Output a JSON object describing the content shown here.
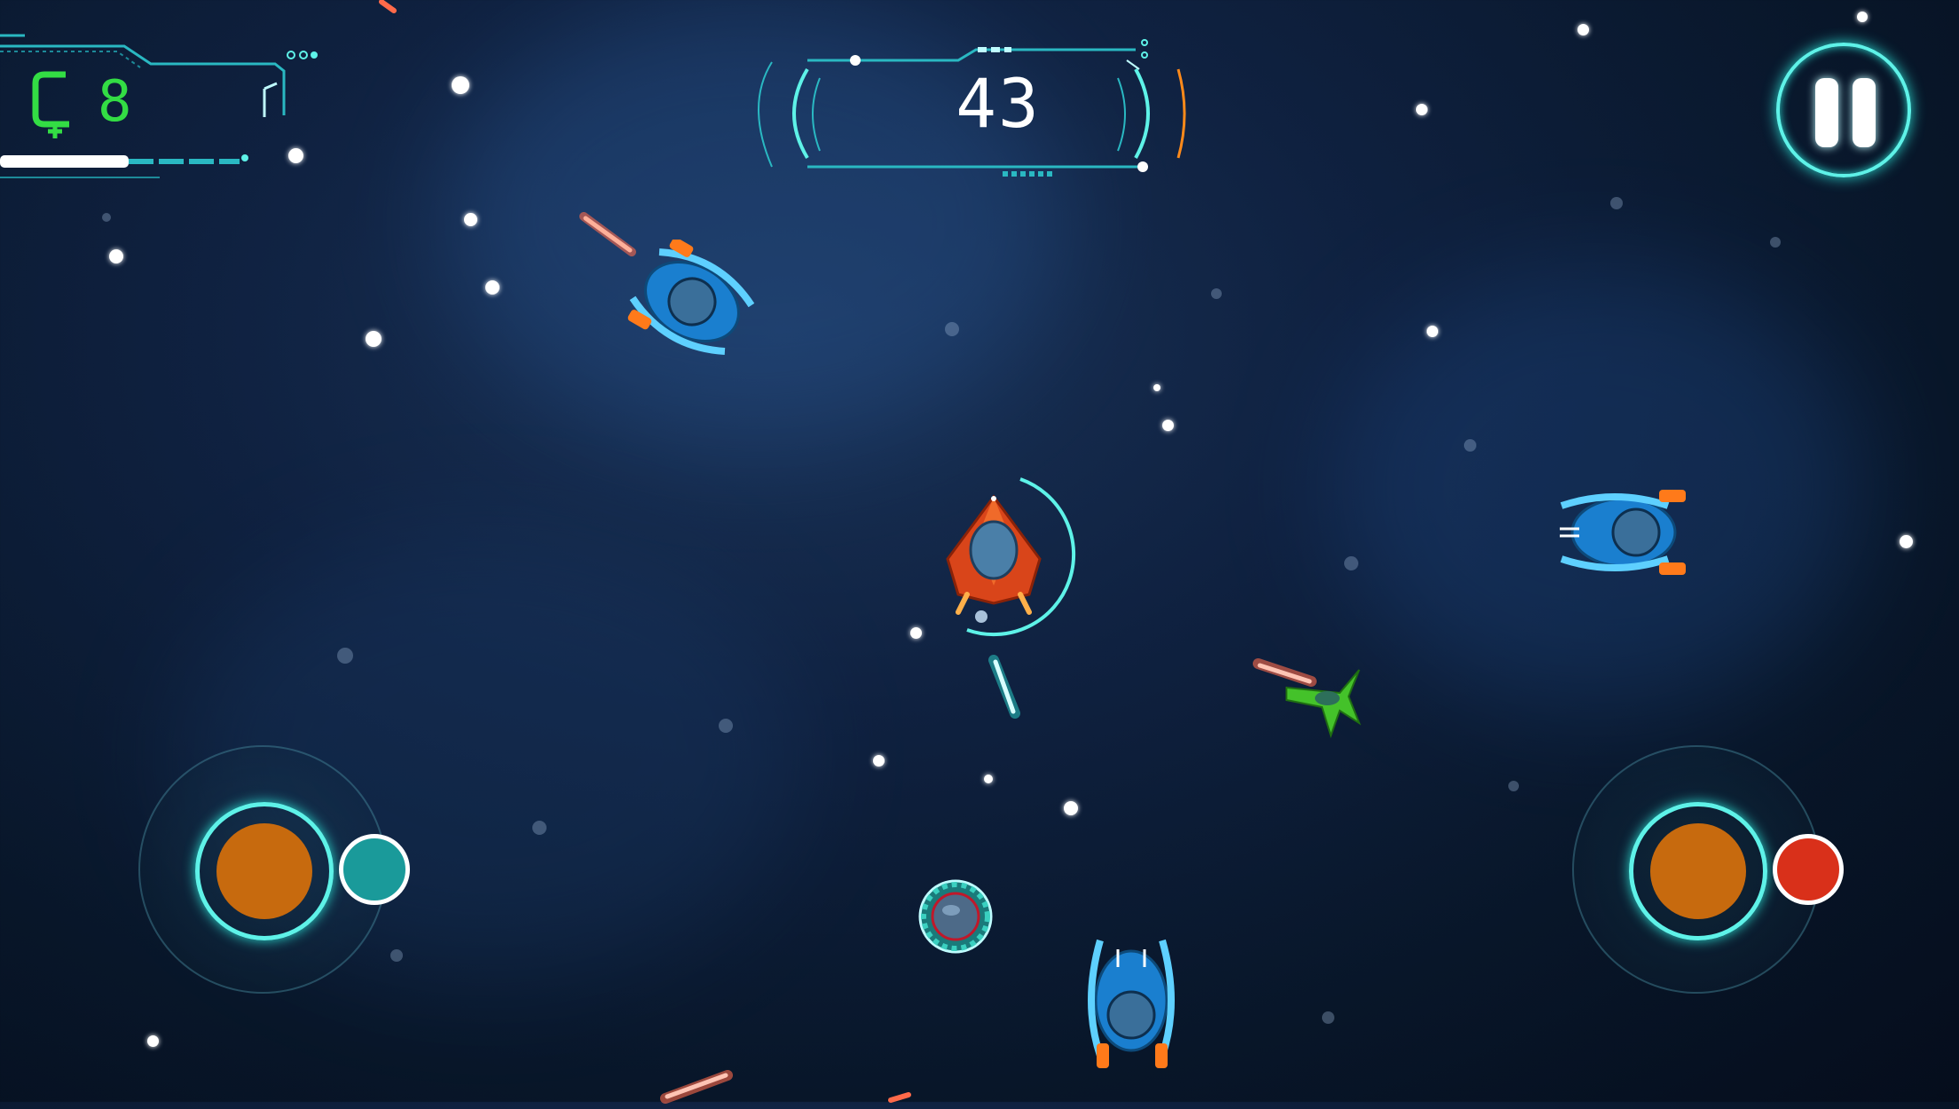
{
  "hud": {
    "coin_icon": "coin-icon",
    "coins": "8",
    "score": "43",
    "pause_icon": "pause-icon"
  },
  "colors": {
    "hud_cyan": "#5ef2e8",
    "coin_green": "#33dd44",
    "joystick_knob": "#c76a0e",
    "left_button": "#1a9a9a",
    "right_button": "#d9301a"
  },
  "controls": {
    "left_joystick": "move-joystick",
    "right_joystick": "aim-joystick",
    "left_button_icon": "teal-dot-icon",
    "right_button_icon": "red-dot-icon"
  }
}
